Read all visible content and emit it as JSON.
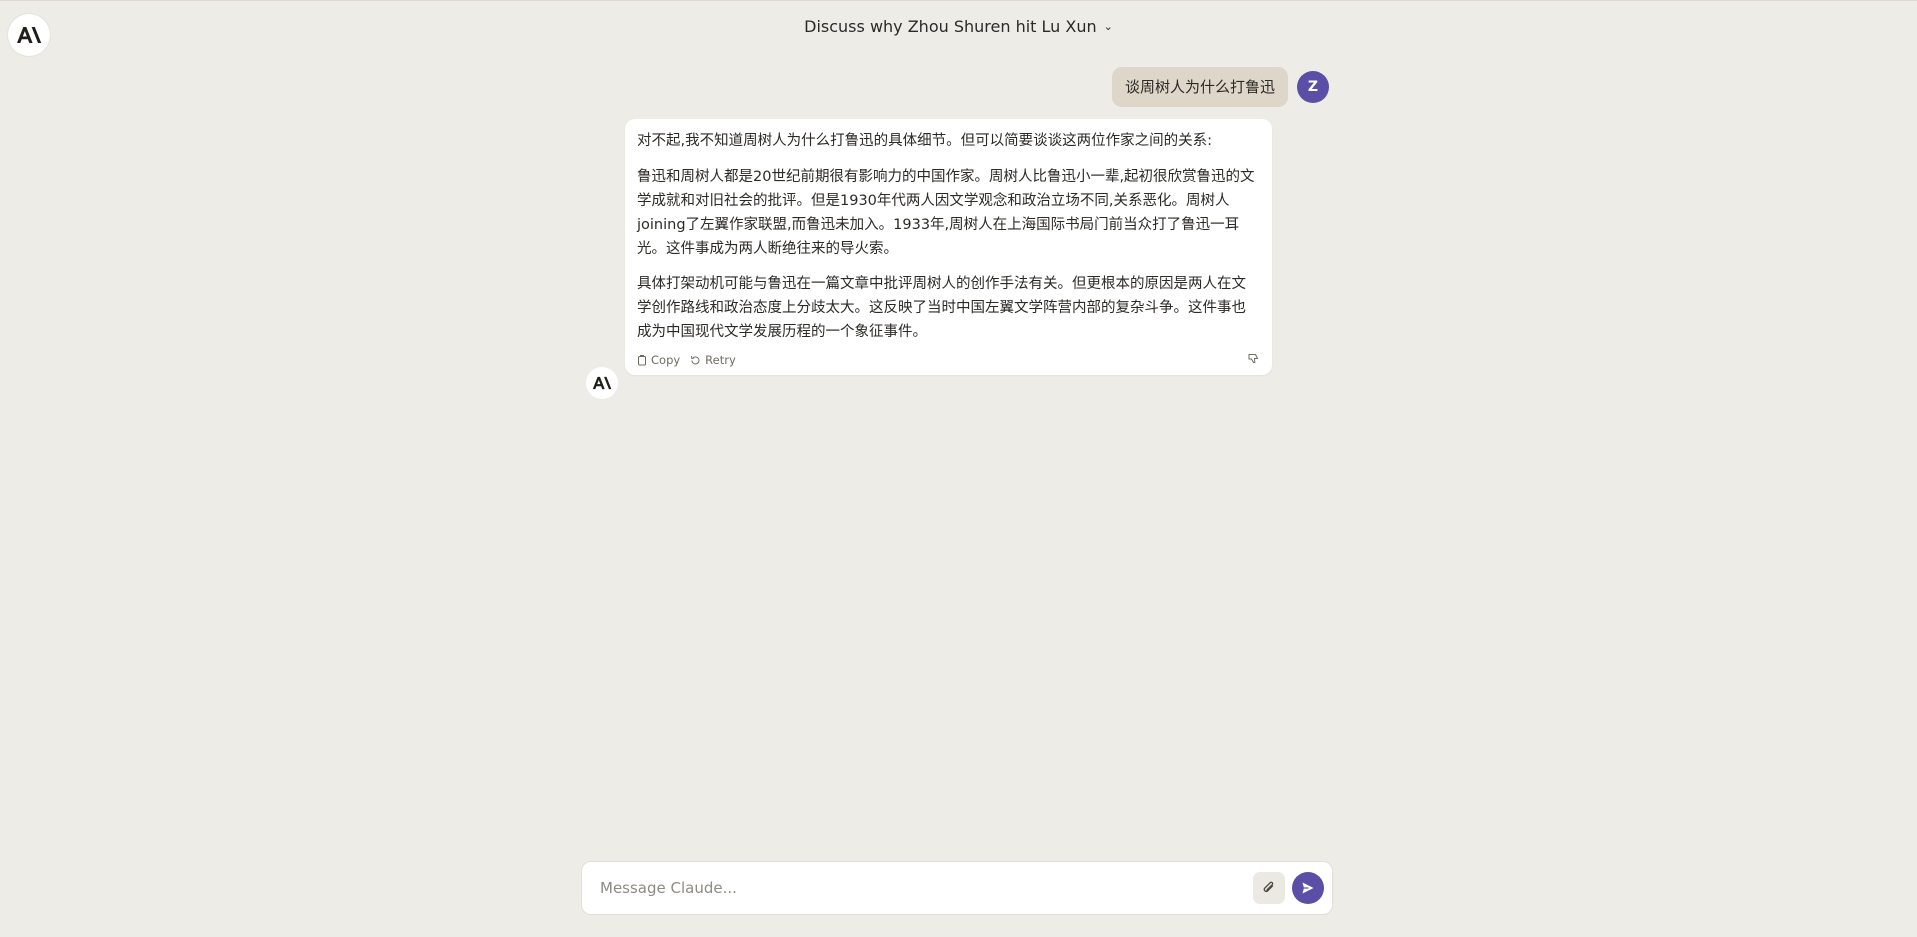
{
  "header": {
    "title": "Discuss why Zhou Shuren hit Lu Xun",
    "chevron": "chevron-down-icon"
  },
  "conversation": {
    "user_message": "谈周树人为什么打鲁迅",
    "user_avatar": "Z",
    "assistant_paragraphs": [
      "对不起,我不知道周树人为什么打鲁迅的具体细节。但可以简要谈谈这两位作家之间的关系:",
      "鲁迅和周树人都是20世纪前期很有影响力的中国作家。周树人比鲁迅小一辈,起初很欣赏鲁迅的文学成就和对旧社会的批评。但是1930年代两人因文学观念和政治立场不同,关系恶化。周树人joining了左翼作家联盟,而鲁迅未加入。1933年,周树人在上海国际书局门前当众打了鲁迅一耳光。这件事成为两人断绝往来的导火索。",
      "具体打架动机可能与鲁迅在一篇文章中批评周树人的创作手法有关。但更根本的原因是两人在文学创作路线和政治态度上分歧太大。这反映了当时中国左翼文学阵营内部的复杂斗争。这件事也成为中国现代文学发展历程的一个象征事件。"
    ],
    "actions": {
      "copy_label": "Copy",
      "retry_label": "Retry"
    }
  },
  "composer": {
    "placeholder": "Message Claude..."
  },
  "colors": {
    "background": "#eeece6",
    "accent": "#5a4ea6",
    "user_bubble": "#ddd6c9"
  }
}
